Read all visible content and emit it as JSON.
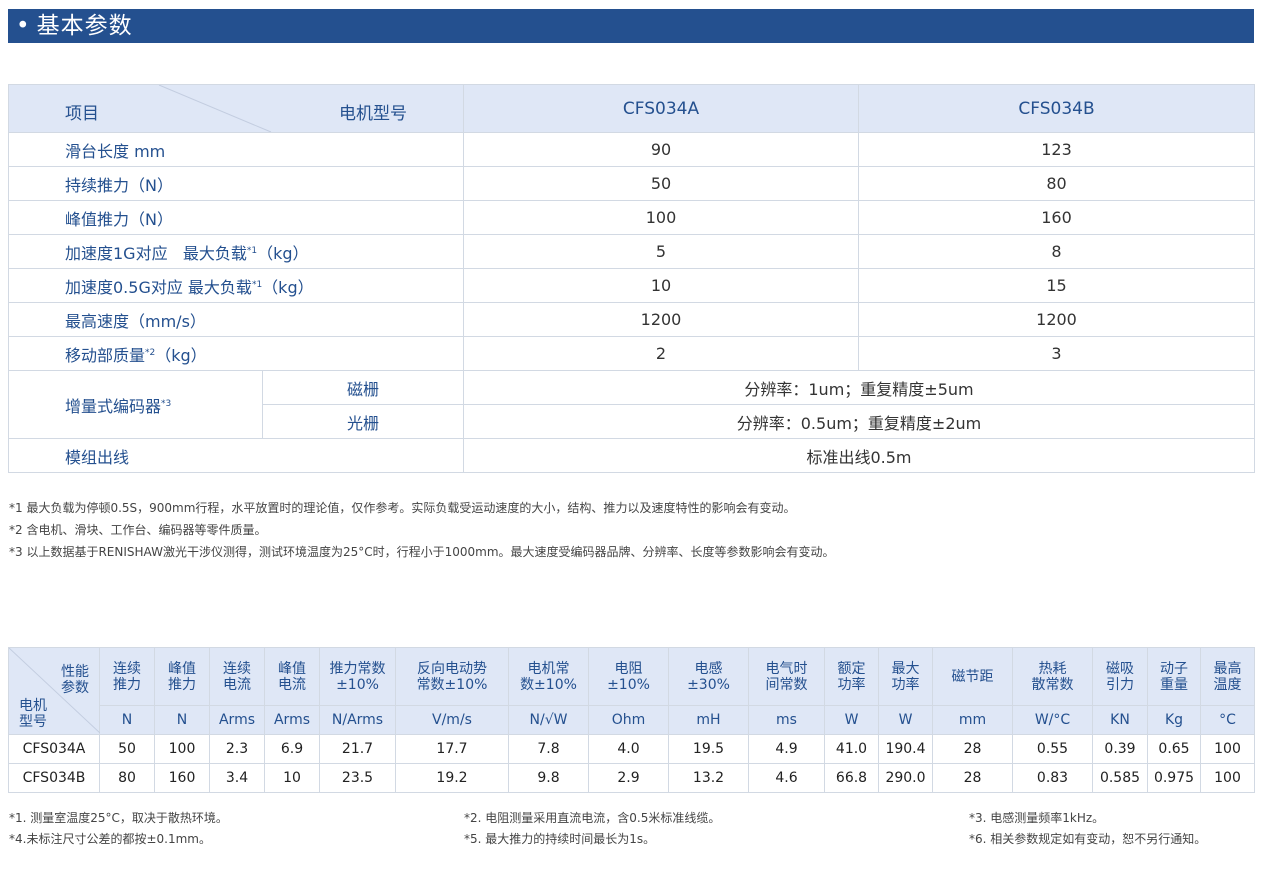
{
  "title": "基本参数",
  "table1": {
    "header": {
      "item": "项目",
      "model": "电机型号",
      "col_a": "CFS034A",
      "col_b": "CFS034B"
    },
    "rows": [
      {
        "label": "滑台长度  mm",
        "a": "90",
        "b": "123"
      },
      {
        "label": "持续推力（N）",
        "a": "50",
        "b": "80"
      },
      {
        "label": "峰值推力（N）",
        "a": "100",
        "b": "160"
      },
      {
        "label_pre": "加速度1G对应   最大负载",
        "label_sup": "*1",
        "label_post": "（kg）",
        "a": "5",
        "b": "8"
      },
      {
        "label_pre": "加速度0.5G对应 最大负载",
        "label_sup": "*1",
        "label_post": "（kg）",
        "a": "10",
        "b": "15"
      },
      {
        "label": "最高速度（mm/s）",
        "a": "1200",
        "b": "1200"
      },
      {
        "label_pre": "移动部质量",
        "label_sup": "*2",
        "label_post": "（kg）",
        "a": "2",
        "b": "3"
      }
    ],
    "encoder": {
      "label": "增量式编码器",
      "sup": "*3",
      "magnetic": "磁栅",
      "magnetic_value": "分辨率：1um；重复精度±5um",
      "optical": "光栅",
      "optical_value": "分辨率：0.5um；重复精度±2um"
    },
    "output": {
      "label": "模组出线",
      "value": "标准出线0.5m"
    }
  },
  "notes1": [
    "*1 最大负载为停顿0.5S，900mm行程，水平放置时的理论值，仅作参考。实际负载受运动速度的大小，结构、推力以及速度特性的影响会有变动。",
    "*2 含电机、滑块、工作台、编码器等零件质量。",
    "*3 以上数据基于RENISHAW激光干涉仪测得，测试环境温度为25°C时，行程小于1000mm。最大速度受编码器品牌、分辨率、长度等参数影响会有变动。"
  ],
  "table2": {
    "corner_top": [
      "性能",
      "参数"
    ],
    "corner_bottom": [
      "电机",
      "型号"
    ],
    "headers": [
      [
        "连续",
        "推力"
      ],
      [
        "峰值",
        "推力"
      ],
      [
        "连续",
        "电流"
      ],
      [
        "峰值",
        "电流"
      ],
      [
        "推力常数",
        "±10%"
      ],
      [
        "反向电动势",
        "常数±10%"
      ],
      [
        "电机常",
        "数±10%"
      ],
      [
        "电阻",
        "±10%"
      ],
      [
        "电感",
        "±30%"
      ],
      [
        "电气时",
        "间常数"
      ],
      [
        "额定",
        "功率"
      ],
      [
        "最大",
        "功率"
      ],
      [
        "磁节距"
      ],
      [
        "热耗",
        "散常数"
      ],
      [
        "磁吸",
        "引力"
      ],
      [
        "动子",
        "重量"
      ],
      [
        "最高",
        "温度"
      ]
    ],
    "units": [
      "N",
      "N",
      "Arms",
      "Arms",
      "N/Arms",
      "V/m/s",
      "N/√W",
      "Ohm",
      "mH",
      "ms",
      "W",
      "W",
      "mm",
      "W/°C",
      "KN",
      "Kg",
      "°C"
    ],
    "rows": [
      {
        "model": "CFS034A",
        "values": [
          "50",
          "100",
          "2.3",
          "6.9",
          "21.7",
          "17.7",
          "7.8",
          "4.0",
          "19.5",
          "4.9",
          "41.0",
          "190.4",
          "28",
          "0.55",
          "0.39",
          "0.65",
          "100"
        ]
      },
      {
        "model": "CFS034B",
        "values": [
          "80",
          "160",
          "3.4",
          "10",
          "23.5",
          "19.2",
          "9.8",
          "2.9",
          "13.2",
          "4.6",
          "66.8",
          "290.0",
          "28",
          "0.83",
          "0.585",
          "0.975",
          "100"
        ]
      }
    ]
  },
  "notes2": {
    "col1": [
      "*1. 测量室温度25°C，取决于散热环境。",
      "*4.未标注尺寸公差的都按±0.1mm。"
    ],
    "col2": [
      "*2. 电阻测量采用直流电流，含0.5米标准线缆。",
      "*5. 最大推力的持续时间最长为1s。"
    ],
    "col3": [
      "*3. 电感测量频率1kHz。",
      "*6. 相关参数规定如有变动，恕不另行通知。"
    ]
  }
}
